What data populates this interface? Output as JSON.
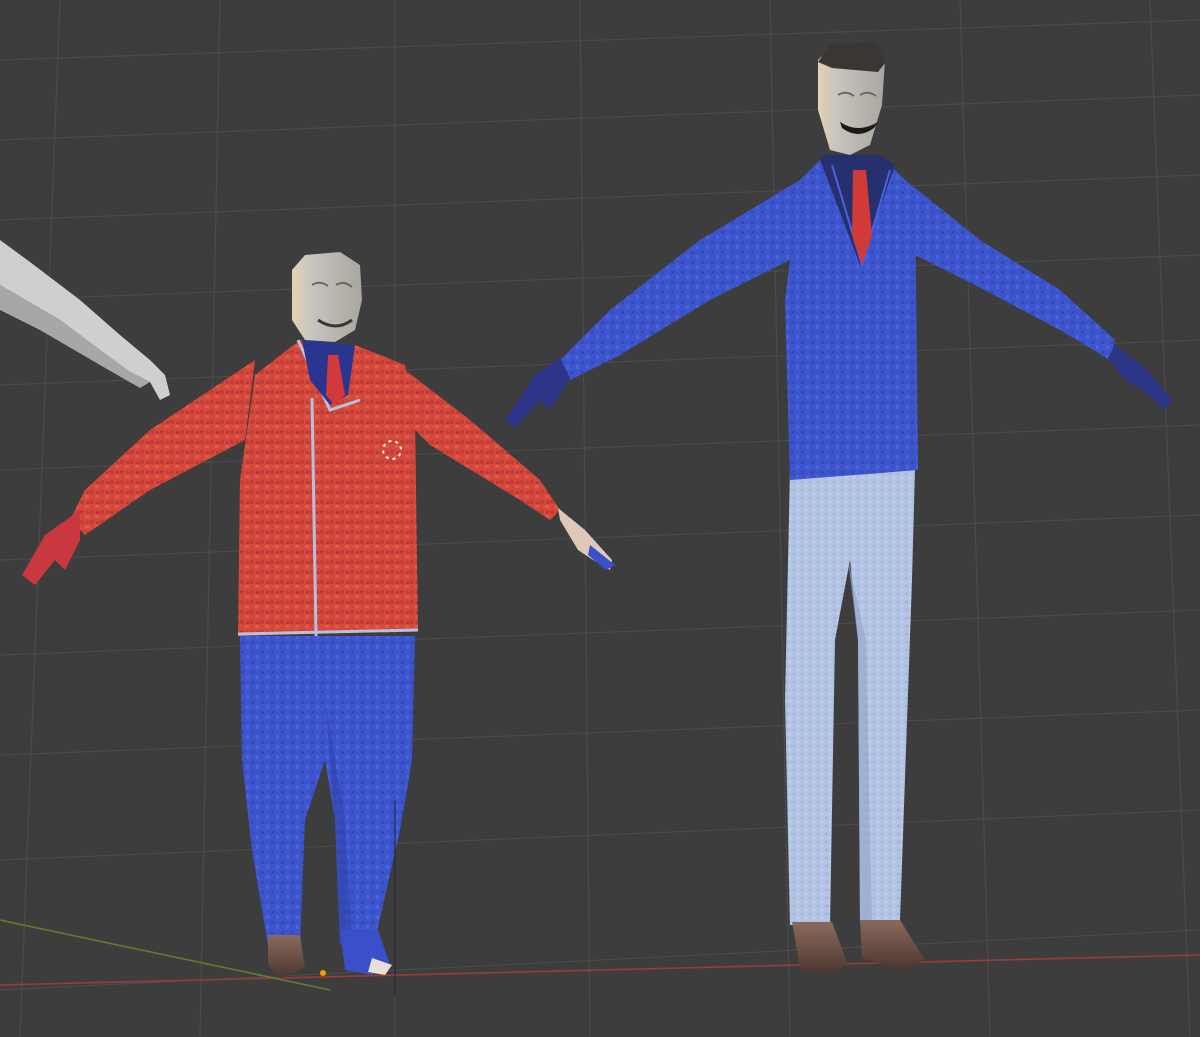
{
  "viewport": {
    "background": "#3d3d3d",
    "grid_line": "#4a4a4a",
    "x_axis_color": "#9b3b3b",
    "y_axis_color": "#5f7f2f"
  },
  "scene": {
    "objects": [
      {
        "name": "partial-white-mannequin-arm",
        "material": "white"
      },
      {
        "name": "short-character",
        "jacket": "#d24a3a",
        "trousers": "#3a50c8",
        "shirt": "#2a3590",
        "tie": "#d23a3a",
        "face": "#b7b5ad"
      },
      {
        "name": "tall-character",
        "jacket": "#3f58d0",
        "trousers": "#aebfe0",
        "shirt": "#2a3590",
        "tie": "#d23a3a",
        "hair": "#3a3633",
        "face": "#b7b5ad"
      }
    ]
  }
}
